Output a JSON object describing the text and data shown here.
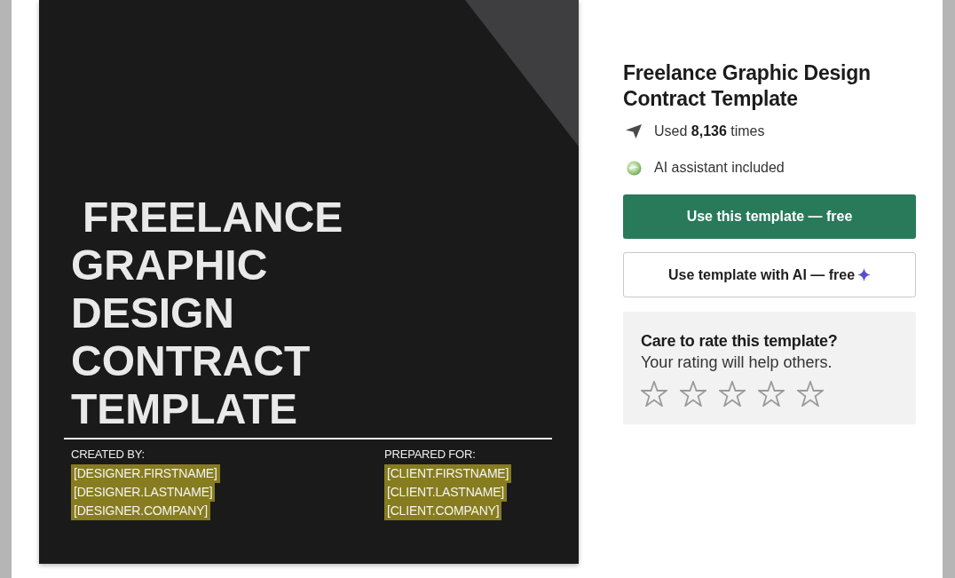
{
  "document_preview": {
    "title": "FREELANCE GRAPHIC DESIGN CONTRACT TEMPLATE",
    "parties": [
      {
        "label": "CREATED BY:",
        "fields": [
          "[DESIGNER.FIRSTNAME]",
          "[DESIGNER.LASTNAME]",
          "[DESIGNER.COMPANY]"
        ]
      },
      {
        "label": "PREPARED FOR:",
        "fields": [
          "[CLIENT.FIRSTNAME]",
          "[CLIENT.LASTNAME]",
          "[CLIENT.COMPANY]"
        ]
      }
    ]
  },
  "template_info": {
    "title": "Freelance Graphic Design Contract Template",
    "features": [
      {
        "kind": "usage",
        "text": "Used **8,136** times"
      },
      {
        "kind": "ai",
        "text": "AI assistant included"
      }
    ],
    "buttons": [
      {
        "kind": "primary",
        "label": "Use this template — free"
      },
      {
        "kind": "ai",
        "label": "Use template with AI — free"
      }
    ]
  },
  "rating": {
    "heading": "Care to rate this template?",
    "subtitle": "Your rating will help others.",
    "stars": 0
  }
}
